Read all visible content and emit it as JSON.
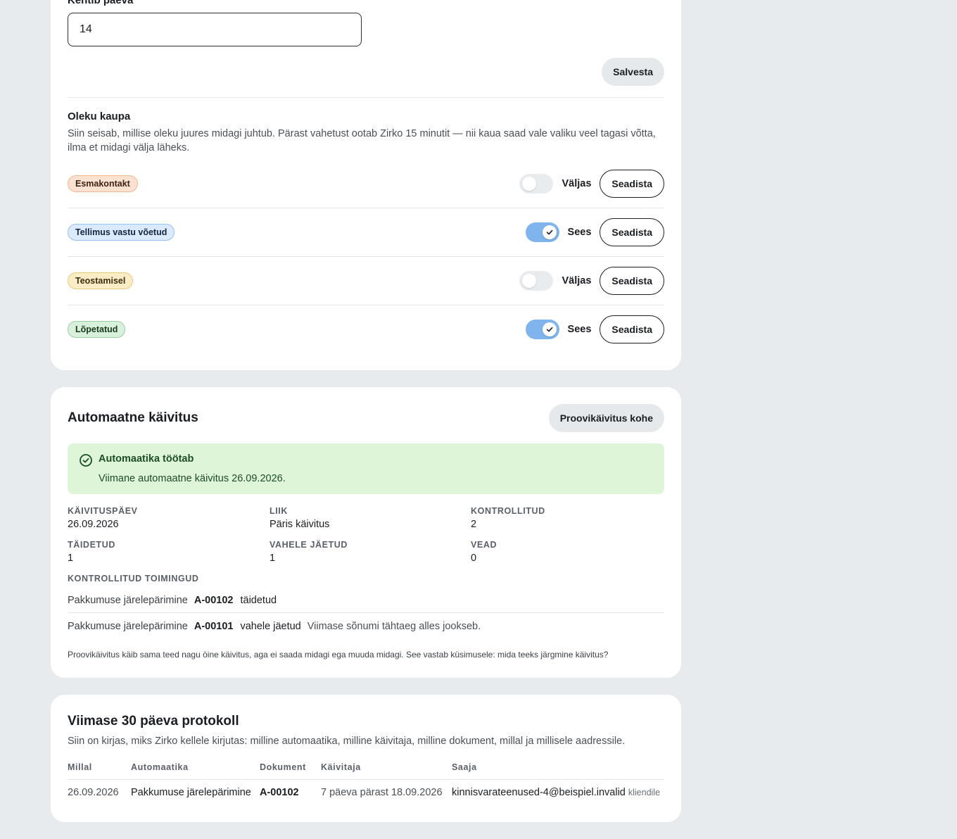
{
  "settings": {
    "days_field_label": "Kehtib päeva",
    "days_value": "14",
    "save_label": "Salvesta",
    "status_section_title": "Oleku kaupa",
    "status_section_desc": "Siin seisab, millise oleku juures midagi juhtub. Pärast vahetust ootab Zirko 15 minutit — nii kaua saad vale valiku veel tagasi võtta, ilma et midagi välja läheks.",
    "configure_label": "Seadista",
    "statuses": [
      {
        "label": "Esmakontakt",
        "color": "#fbe1cf",
        "enabled": false,
        "state_label": "Väljas"
      },
      {
        "label": "Tellimus vastu võetud",
        "color": "#dbeafe",
        "enabled": true,
        "state_label": "Sees"
      },
      {
        "label": "Teostamisel",
        "color": "#faecc4",
        "enabled": false,
        "state_label": "Väljas"
      },
      {
        "label": "Lõpetatud",
        "color": "#d9f0dc",
        "enabled": true,
        "state_label": "Sees"
      }
    ]
  },
  "auto_run": {
    "title": "Automaatne käivitus",
    "test_run_label": "Proovikäivitus kohe",
    "alert_title": "Automaatika töötab",
    "alert_text": "Viimane automaatne käivitus 26.09.2026.",
    "alert_icon": "check-circle-icon",
    "stats": [
      {
        "label": "Käivituspäev",
        "value": "26.09.2026"
      },
      {
        "label": "Liik",
        "value": "Päris käivitus"
      },
      {
        "label": "Kontrollitud",
        "value": "2"
      },
      {
        "label": "Täidetud",
        "value": "1"
      },
      {
        "label": "Vahele jäetud",
        "value": "1"
      },
      {
        "label": "Vead",
        "value": "0"
      }
    ],
    "actions_label": "Kontrollitud toimingud",
    "actions": [
      {
        "name": "Pakkumuse järelepärimine",
        "doc": "A-00102",
        "state": "täidetud",
        "note": ""
      },
      {
        "name": "Pakkumuse järelepärimine",
        "doc": "A-00101",
        "state": "vahele jäetud",
        "note": "Viimase sõnumi tähtaeg alles jookseb."
      }
    ],
    "footnote": "Proovikäivitus käib sama teed nagu öine käivitus, aga ei saada midagi ega muuda midagi. See vastab küsimusele: mida teeks järgmine käivitus?"
  },
  "log": {
    "title": "Viimase 30 päeva protokoll",
    "desc": "Siin on kirjas, miks Zirko kellele kirjutas: milline automaatika, milline käivitaja, milline dokument, millal ja millisele aadressile.",
    "columns": [
      "Millal",
      "Automaatika",
      "Dokument",
      "Käivitaja",
      "Saaja"
    ],
    "rows": [
      {
        "when": "26.09.2026",
        "automation": "Pakkumuse järelepärimine",
        "document": "A-00102",
        "trigger": "7 päeva pärast 18.09.2026",
        "recipient": "kinnisvarateenused-4@beispiel.invalid",
        "recipient_kind": "kliendile"
      }
    ]
  }
}
